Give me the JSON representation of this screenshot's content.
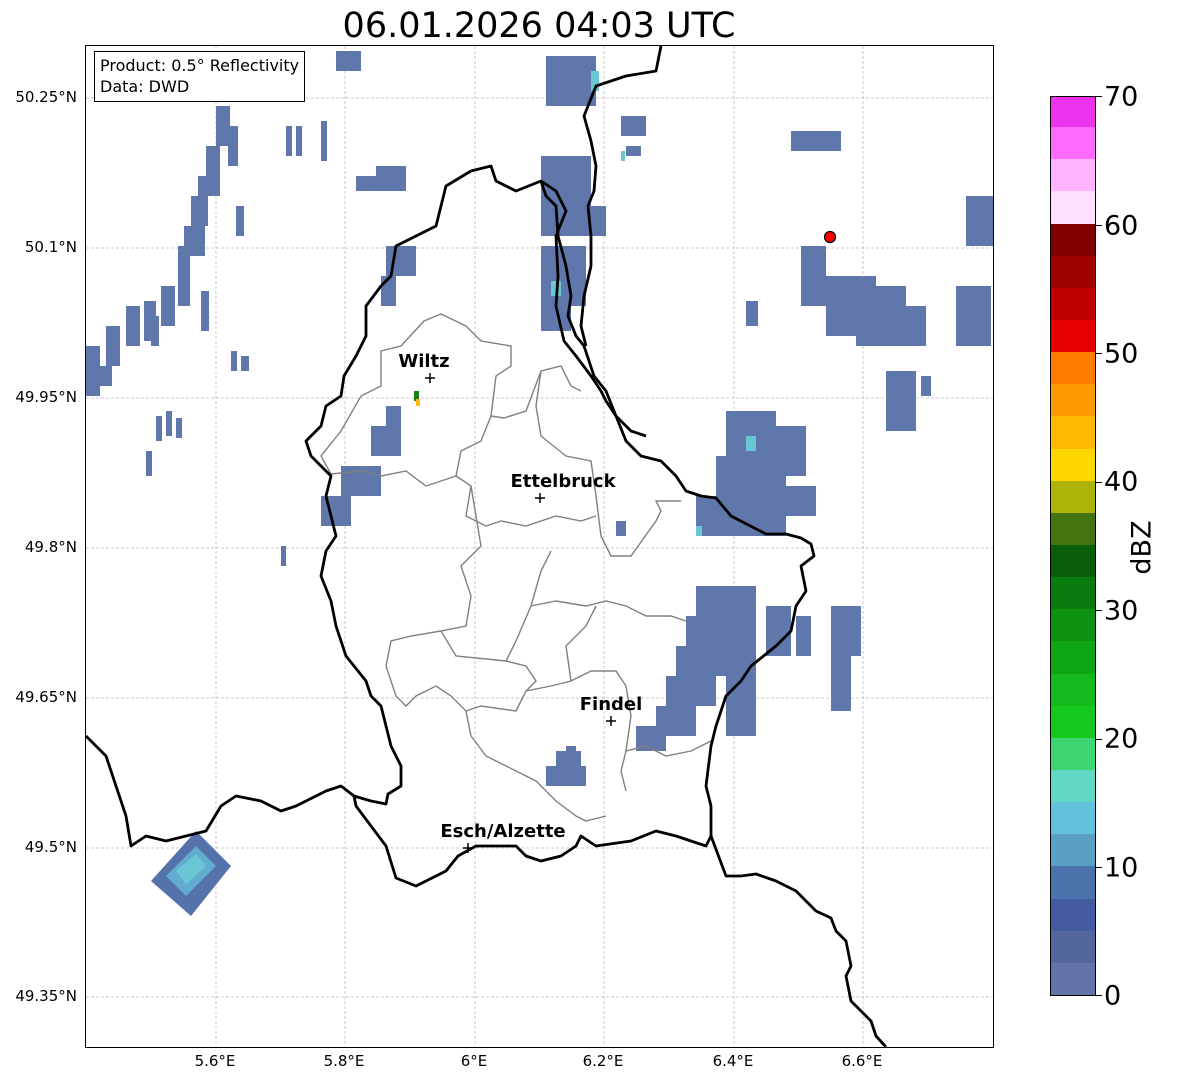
{
  "title": "06.01.2026 04:03 UTC",
  "info": {
    "product": "Product: 0.5° Reflectivity",
    "data": "Data: DWD"
  },
  "lat_labels": [
    "50.25°N",
    "50.1°N",
    "49.95°N",
    "49.8°N",
    "49.65°N",
    "49.5°N",
    "49.35°N"
  ],
  "lon_labels": [
    "5.6°E",
    "5.8°E",
    "6°E",
    "6.2°E",
    "6.4°E",
    "6.6°E"
  ],
  "cities": [
    {
      "name": "Wiltz"
    },
    {
      "name": "Ettelbruck"
    },
    {
      "name": "Findel"
    },
    {
      "name": "Esch/Alzette"
    }
  ],
  "colorbar": {
    "unit": "dBZ",
    "labels": [
      "70",
      "60",
      "50",
      "40",
      "30",
      "20",
      "10",
      "0"
    ],
    "colors": [
      "#6274a8",
      "#53679e",
      "#425c9f",
      "#4a73ad",
      "#5aa0c6",
      "#64c3dc",
      "#60d8c4",
      "#3dd472",
      "#14c81e",
      "#14ba1b",
      "#0ea614",
      "#0c9210",
      "#0a7c0e",
      "#085e0b",
      "#447410",
      "#aeb30a",
      "#ffd700",
      "#ffb800",
      "#ff9a00",
      "#ff7c00",
      "#e60000",
      "#c00000",
      "#a00000",
      "#800000",
      "#ffe0ff",
      "#ffb3ff",
      "#ff6bff",
      "#ee33ee"
    ]
  },
  "map_style": {
    "country_border": "#000000",
    "canton_border": "#808080",
    "grid": "#bbbbbb",
    "radar_site": "#ff0000"
  }
}
